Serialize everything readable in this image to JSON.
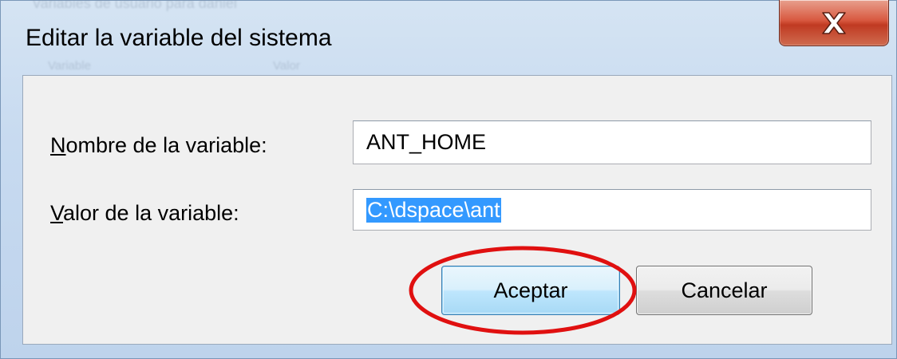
{
  "window": {
    "title": "Editar la variable del sistema",
    "ghost_text": {
      "line1": "Variables de usuario para daniel",
      "col1": "Variable",
      "col2": "Valor"
    }
  },
  "form": {
    "name_label": {
      "mnemonic": "N",
      "rest": "ombre de la variable:"
    },
    "name_value": "ANT_HOME",
    "value_label": {
      "mnemonic": "V",
      "rest": "alor de la variable:"
    },
    "value_value": "C:\\dspace\\ant"
  },
  "buttons": {
    "accept": "Aceptar",
    "cancel": "Cancelar"
  },
  "icons": {
    "close": "close-icon"
  },
  "annotation": {
    "color": "#e01010",
    "target": "accept-button"
  }
}
